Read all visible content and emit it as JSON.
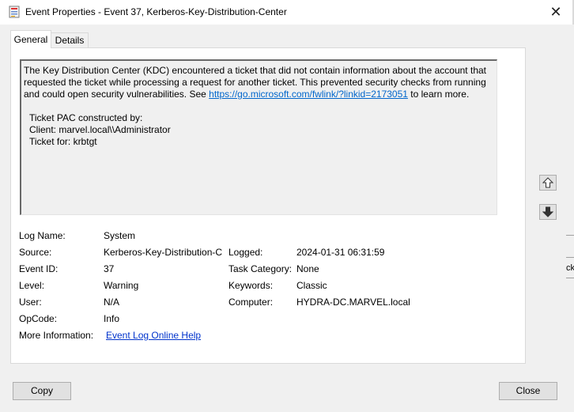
{
  "window": {
    "title": "Event Properties - Event 37, Kerberos-Key-Distribution-Center",
    "close_glyph": "✕"
  },
  "tabs": [
    {
      "label": "General"
    },
    {
      "label": "Details"
    }
  ],
  "description": {
    "text_before_link": "The Key Distribution Center (KDC) encountered a ticket that did not contain information about the account that requested the ticket while processing a request for another ticket. This prevented security checks from running and could open security vulnerabilities. See ",
    "link": "https://go.microsoft.com/fwlink/?linkid=2173051",
    "text_after_link": " to learn more.",
    "line1": "Ticket PAC constructed by:",
    "line2": "Client: marvel.local\\\\Administrator",
    "line3": "Ticket for: krbtgt"
  },
  "fields": {
    "log_name": {
      "label": "Log Name:",
      "value": "System"
    },
    "source": {
      "label": "Source:",
      "value": "Kerberos-Key-Distribution-C"
    },
    "logged": {
      "label": "Logged:",
      "value": "2024-01-31 06:31:59"
    },
    "event_id": {
      "label": "Event ID:",
      "value": "37"
    },
    "task_category": {
      "label": "Task Category:",
      "value": "None"
    },
    "level": {
      "label": "Level:",
      "value": "Warning"
    },
    "keywords": {
      "label": "Keywords:",
      "value": "Classic"
    },
    "user": {
      "label": "User:",
      "value": "N/A"
    },
    "computer": {
      "label": "Computer:",
      "value": "HYDRA-DC.MARVEL.local"
    },
    "opcode": {
      "label": "OpCode:",
      "value": "Info"
    },
    "more_info": {
      "label": "More Information:",
      "link": "Event Log Online Help"
    }
  },
  "buttons": {
    "copy": "Copy",
    "close": "Close"
  },
  "icons": {
    "app": "event-viewer-icon",
    "up": "arrow-up-icon",
    "down": "arrow-down-icon"
  },
  "background_edge_text": "ck"
}
